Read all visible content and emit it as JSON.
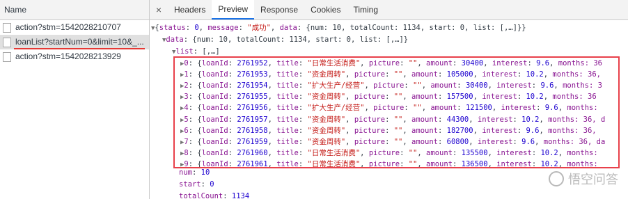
{
  "left": {
    "header": "Name",
    "requests": [
      {
        "name": "action?stm=1542028210707",
        "selected": false
      },
      {
        "name": "loanList?startNum=0&limit=10&_...",
        "selected": true
      },
      {
        "name": "action?stm=1542028213929",
        "selected": false
      }
    ]
  },
  "tabs": {
    "close": "×",
    "items": [
      "Headers",
      "Preview",
      "Response",
      "Cookies",
      "Timing"
    ],
    "active": "Preview"
  },
  "preview": {
    "root": {
      "prefix": "{",
      "k1": "status",
      "v1": "0",
      "k2": "message",
      "v2": "\"成功\"",
      "k3": "data",
      "rest": "{num: 10, totalCount: 1134, start: 0, list: [,…]}}"
    },
    "data": {
      "key": "data",
      "rest": "{num: 10, totalCount: 1134, start: 0, list: [,…]}"
    },
    "list": {
      "key": "list",
      "rest": "[,…]"
    },
    "items": [
      {
        "idx": "0",
        "loanId": "2761952",
        "title": "\"日常生活消费\"",
        "picture": "\"\"",
        "amount": "30400",
        "interest": "9.6",
        "tail": "months: 36"
      },
      {
        "idx": "1",
        "loanId": "2761953",
        "title": "\"资金周转\"",
        "picture": "\"\"",
        "amount": "105000",
        "interest": "10.2",
        "tail": "months: 36,"
      },
      {
        "idx": "2",
        "loanId": "2761954",
        "title": "\"扩大生产/经营\"",
        "picture": "\"\"",
        "amount": "30400",
        "interest": "9.6",
        "tail": "months: 3"
      },
      {
        "idx": "3",
        "loanId": "2761955",
        "title": "\"资金周转\"",
        "picture": "\"\"",
        "amount": "157500",
        "interest": "10.2",
        "tail": "months: 36"
      },
      {
        "idx": "4",
        "loanId": "2761956",
        "title": "\"扩大生产/经营\"",
        "picture": "\"\"",
        "amount": "121500",
        "interest": "9.6",
        "tail": "months:"
      },
      {
        "idx": "5",
        "loanId": "2761957",
        "title": "\"资金周转\"",
        "picture": "\"\"",
        "amount": "44300",
        "interest": "10.2",
        "tail": "months: 36, d"
      },
      {
        "idx": "6",
        "loanId": "2761958",
        "title": "\"资金周转\"",
        "picture": "\"\"",
        "amount": "182700",
        "interest": "9.6",
        "tail": "months: 36,"
      },
      {
        "idx": "7",
        "loanId": "2761959",
        "title": "\"资金周转\"",
        "picture": "\"\"",
        "amount": "60800",
        "interest": "9.6",
        "tail": "months: 36, da"
      },
      {
        "idx": "8",
        "loanId": "2761960",
        "title": "\"日常生活消费\"",
        "picture": "\"\"",
        "amount": "135500",
        "interest": "10.2",
        "tail": "months:"
      },
      {
        "idx": "9",
        "loanId": "2761961",
        "title": "\"日常生活消费\"",
        "picture": "\"\"",
        "amount": "136500",
        "interest": "10.2",
        "tail": "months:"
      }
    ],
    "num": {
      "key": "num",
      "value": "10"
    },
    "start": {
      "key": "start",
      "value": "0"
    },
    "totalCount": {
      "key": "totalCount",
      "value": "1134"
    }
  },
  "watermark": "悟空问答"
}
